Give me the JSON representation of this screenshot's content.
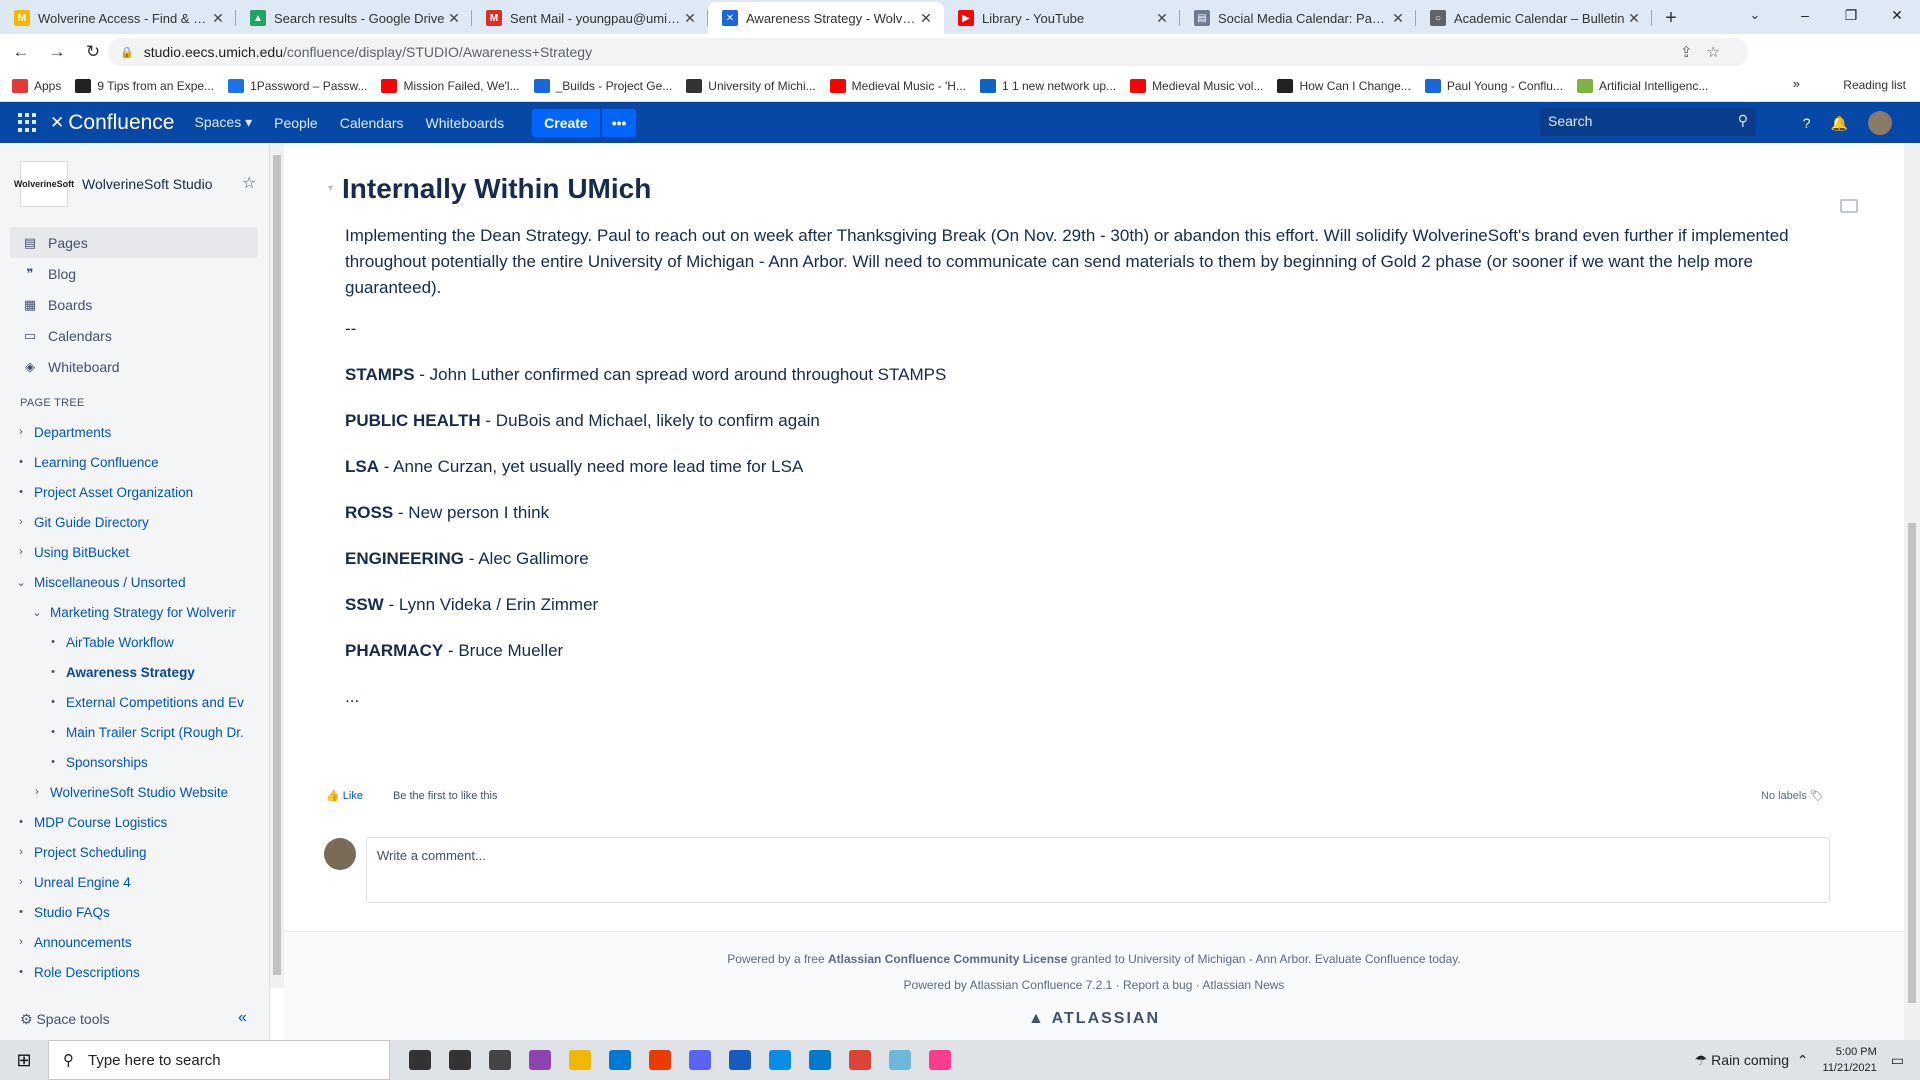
{
  "browser": {
    "tabs": [
      {
        "title": "Wolverine Access - Find & Favor",
        "color": "#f5b800",
        "glyph": "M",
        "active": false
      },
      {
        "title": "Search results - Google Drive",
        "color": "#1fa463",
        "glyph": "▲",
        "active": false
      },
      {
        "title": "Sent Mail - youngpau@umich.e",
        "color": "#d93025",
        "glyph": "M",
        "active": false
      },
      {
        "title": "Awareness Strategy - Wolverine",
        "color": "#1868db",
        "glyph": "✕",
        "active": true
      },
      {
        "title": "Library - YouTube",
        "color": "#ff0000",
        "glyph": "▶",
        "active": false
      },
      {
        "title": "Social Media Calendar: Passwor",
        "color": "#6b7c93",
        "glyph": "▤",
        "active": false
      },
      {
        "title": "Academic Calendar – Bulletin",
        "color": "#5f6368",
        "glyph": "○",
        "active": false
      }
    ],
    "new_tab": "+",
    "url_host": "studio.eecs.umich.edu",
    "url_path": "/confluence/display/STUDIO/Awareness+Strategy",
    "bookmarks": [
      {
        "label": "Apps",
        "color": "#e53935"
      },
      {
        "label": "9 Tips from an Expe...",
        "color": "#222"
      },
      {
        "label": "1Password – Passw...",
        "color": "#1a73e8"
      },
      {
        "label": "Mission Failed, We'l...",
        "color": "#ff0000"
      },
      {
        "label": "_Builds - Project Ge...",
        "color": "#1868db"
      },
      {
        "label": "University of Michi...",
        "color": "#333"
      },
      {
        "label": "Medieval Music - 'H...",
        "color": "#ff0000"
      },
      {
        "label": "1 1 new network up...",
        "color": "#0a66c2"
      },
      {
        "label": "Medieval Music vol...",
        "color": "#ff0000"
      },
      {
        "label": "How Can I Change...",
        "color": "#222"
      },
      {
        "label": "Paul Young - Conflu...",
        "color": "#1868db"
      },
      {
        "label": "Artificial Intelligenc...",
        "color": "#7cb342"
      }
    ],
    "reading_list": "Reading list"
  },
  "confluence": {
    "logo": "Confluence",
    "nav": [
      "Spaces ▾",
      "People",
      "Calendars",
      "Whiteboards"
    ],
    "create": "Create",
    "more": "•••",
    "search_placeholder": "Search"
  },
  "sidebar": {
    "space_name": "WolverineSoft Studio",
    "space_logo_text": "WolverineSoft",
    "nav": [
      {
        "label": "Pages",
        "icon": "▤"
      },
      {
        "label": "Blog",
        "icon": "❞"
      },
      {
        "label": "Boards",
        "icon": "▦"
      },
      {
        "label": "Calendars",
        "icon": "▭"
      },
      {
        "label": "Whiteboard",
        "icon": "◈"
      }
    ],
    "tree_header": "PAGE TREE",
    "tree": [
      {
        "label": "Departments",
        "marker": "›",
        "indent": 0
      },
      {
        "label": "Learning Confluence",
        "marker": "•",
        "indent": 0
      },
      {
        "label": "Project Asset Organization",
        "marker": "•",
        "indent": 0
      },
      {
        "label": "Git Guide Directory",
        "marker": "›",
        "indent": 0
      },
      {
        "label": "Using BitBucket",
        "marker": "›",
        "indent": 0
      },
      {
        "label": "Miscellaneous / Unsorted",
        "marker": "⌄",
        "indent": 0
      },
      {
        "label": "Marketing Strategy for Wolverir",
        "marker": "⌄",
        "indent": 1
      },
      {
        "label": "AirTable Workflow",
        "marker": "•",
        "indent": 2
      },
      {
        "label": "Awareness Strategy",
        "marker": "•",
        "indent": 2,
        "current": true
      },
      {
        "label": "External Competitions and Ev",
        "marker": "•",
        "indent": 2
      },
      {
        "label": "Main Trailer Script (Rough Dr.",
        "marker": "•",
        "indent": 2
      },
      {
        "label": "Sponsorships",
        "marker": "•",
        "indent": 2
      },
      {
        "label": "WolverineSoft Studio Website",
        "marker": "›",
        "indent": 1
      },
      {
        "label": "MDP Course Logistics",
        "marker": "•",
        "indent": 0
      },
      {
        "label": "Project Scheduling",
        "marker": "›",
        "indent": 0
      },
      {
        "label": "Unreal Engine 4",
        "marker": "›",
        "indent": 0
      },
      {
        "label": "Studio FAQs",
        "marker": "•",
        "indent": 0
      },
      {
        "label": "Announcements",
        "marker": "›",
        "indent": 0
      },
      {
        "label": "Role Descriptions",
        "marker": "•",
        "indent": 0
      }
    ],
    "space_tools": "Space tools",
    "collapse": "«"
  },
  "page": {
    "heading": "Internally Within UMich",
    "intro": "Implementing the Dean Strategy. Paul to reach out on week after Thanksgiving Break  (On Nov. 29th - 30th) or abandon this effort. Will solidify WolverineSoft's brand even further if implemented throughout potentially the entire University of Michigan - Ann Arbor. Will need to communicate can send materials to them by beginning of Gold 2 phase (or sooner if we want the help more guaranteed).",
    "divider": "--",
    "contacts": [
      {
        "school": "STAMPS",
        "text": " - John Luther confirmed can spread word around throughout STAMPS"
      },
      {
        "school": "PUBLIC HEALTH",
        "text": " - DuBois and Michael, likely to confirm again"
      },
      {
        "school": "LSA",
        "text": " - Anne Curzan, yet usually need more lead time for LSA"
      },
      {
        "school": "ROSS",
        "text": " - New person I think"
      },
      {
        "school": "ENGINEERING",
        "text": " - Alec Gallimore"
      },
      {
        "school": "SSW",
        "text": " - Lynn Videka / Erin Zimmer"
      },
      {
        "school": "PHARMACY",
        "text": " - Bruce Mueller"
      }
    ],
    "ellipsis": "...",
    "like": "Like",
    "like_hint": "Be the first to like this",
    "labels": "No labels",
    "comment_placeholder": "Write a comment..."
  },
  "footer": {
    "prefix": "Powered by a free ",
    "license": "Atlassian Confluence Community License",
    "suffix": " granted to University of Michigan - Ann Arbor. Evaluate Confluence today.",
    "line2": "Powered by Atlassian Confluence 7.2.1  ·  Report a bug  ·  Atlassian News",
    "brand": "▲ ATLASSIAN"
  },
  "taskbar": {
    "search_placeholder": "Type here to search",
    "weather": "Rain coming",
    "time": "5:00 PM",
    "date": "11/21/2021",
    "apps": [
      {
        "name": "cortana-icon",
        "color": "#333"
      },
      {
        "name": "task-view-icon",
        "color": "#333"
      },
      {
        "name": "store-icon",
        "color": "#444"
      },
      {
        "name": "podcast-app-icon",
        "color": "#8e44ad"
      },
      {
        "name": "file-explorer-icon",
        "color": "#f2b705"
      },
      {
        "name": "mail-icon",
        "color": "#0078d4"
      },
      {
        "name": "office-icon",
        "color": "#eb3c00"
      },
      {
        "name": "discord-icon",
        "color": "#5865f2"
      },
      {
        "name": "word-icon",
        "color": "#185abd"
      },
      {
        "name": "edge-icon",
        "color": "#0c8ce9"
      },
      {
        "name": "vscode-icon",
        "color": "#007acc"
      },
      {
        "name": "chrome-icon",
        "color": "#db4437"
      },
      {
        "name": "notes-icon",
        "color": "#6fb7d9"
      },
      {
        "name": "itunes-icon",
        "color": "#fc3c8d"
      }
    ]
  }
}
